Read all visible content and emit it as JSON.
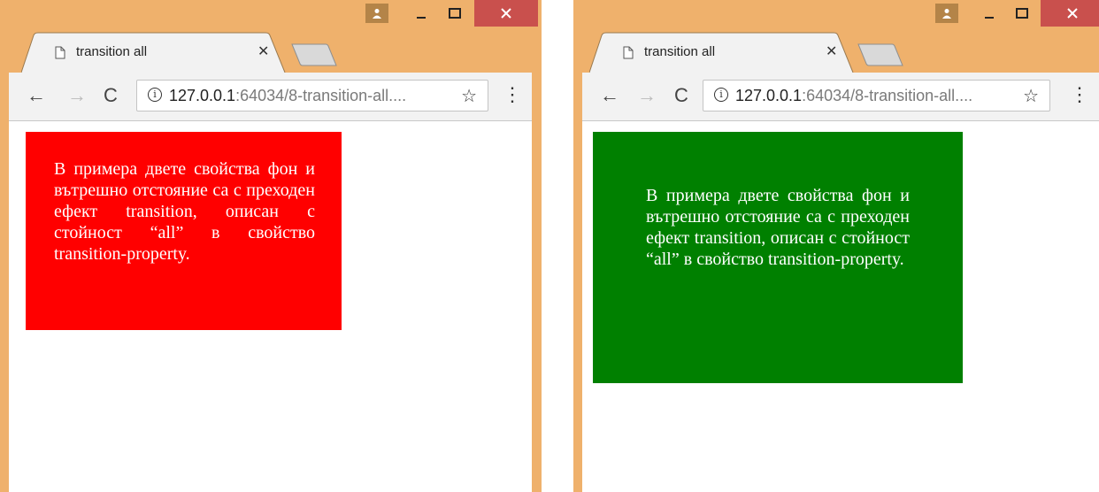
{
  "windows": [
    {
      "tab_title": "transition all",
      "url_host": "127.0.0.1",
      "url_rest": ":64034/8-transition-all....",
      "box_text": "В примера двете свойства фон и вътрешно отстояние са с преходен ефект transition, описан с стойност “all” в свойство transition-property.",
      "box_color": "#ff0000"
    },
    {
      "tab_title": "transition all",
      "url_host": "127.0.0.1",
      "url_rest": ":64034/8-transition-all....",
      "box_text": "В примера двете свойства фон и вътрешно отстояние са с преходен ефект transition, описан с стойност “all” в свойство transition-property.",
      "box_color": "#008000"
    }
  ],
  "icons": {
    "profile": "person-icon",
    "minimize": "minimize-icon",
    "maximize": "maximize-icon",
    "close": "close-icon",
    "page": "page-icon",
    "tab_close": "tab-close-icon",
    "back": "back-arrow-icon",
    "forward": "forward-arrow-icon",
    "reload": "reload-icon",
    "info": "info-icon",
    "bookmark": "star-icon",
    "menu": "kebab-menu-icon"
  },
  "colors": {
    "frame": "#efb16c",
    "close_button": "#c9504d"
  }
}
